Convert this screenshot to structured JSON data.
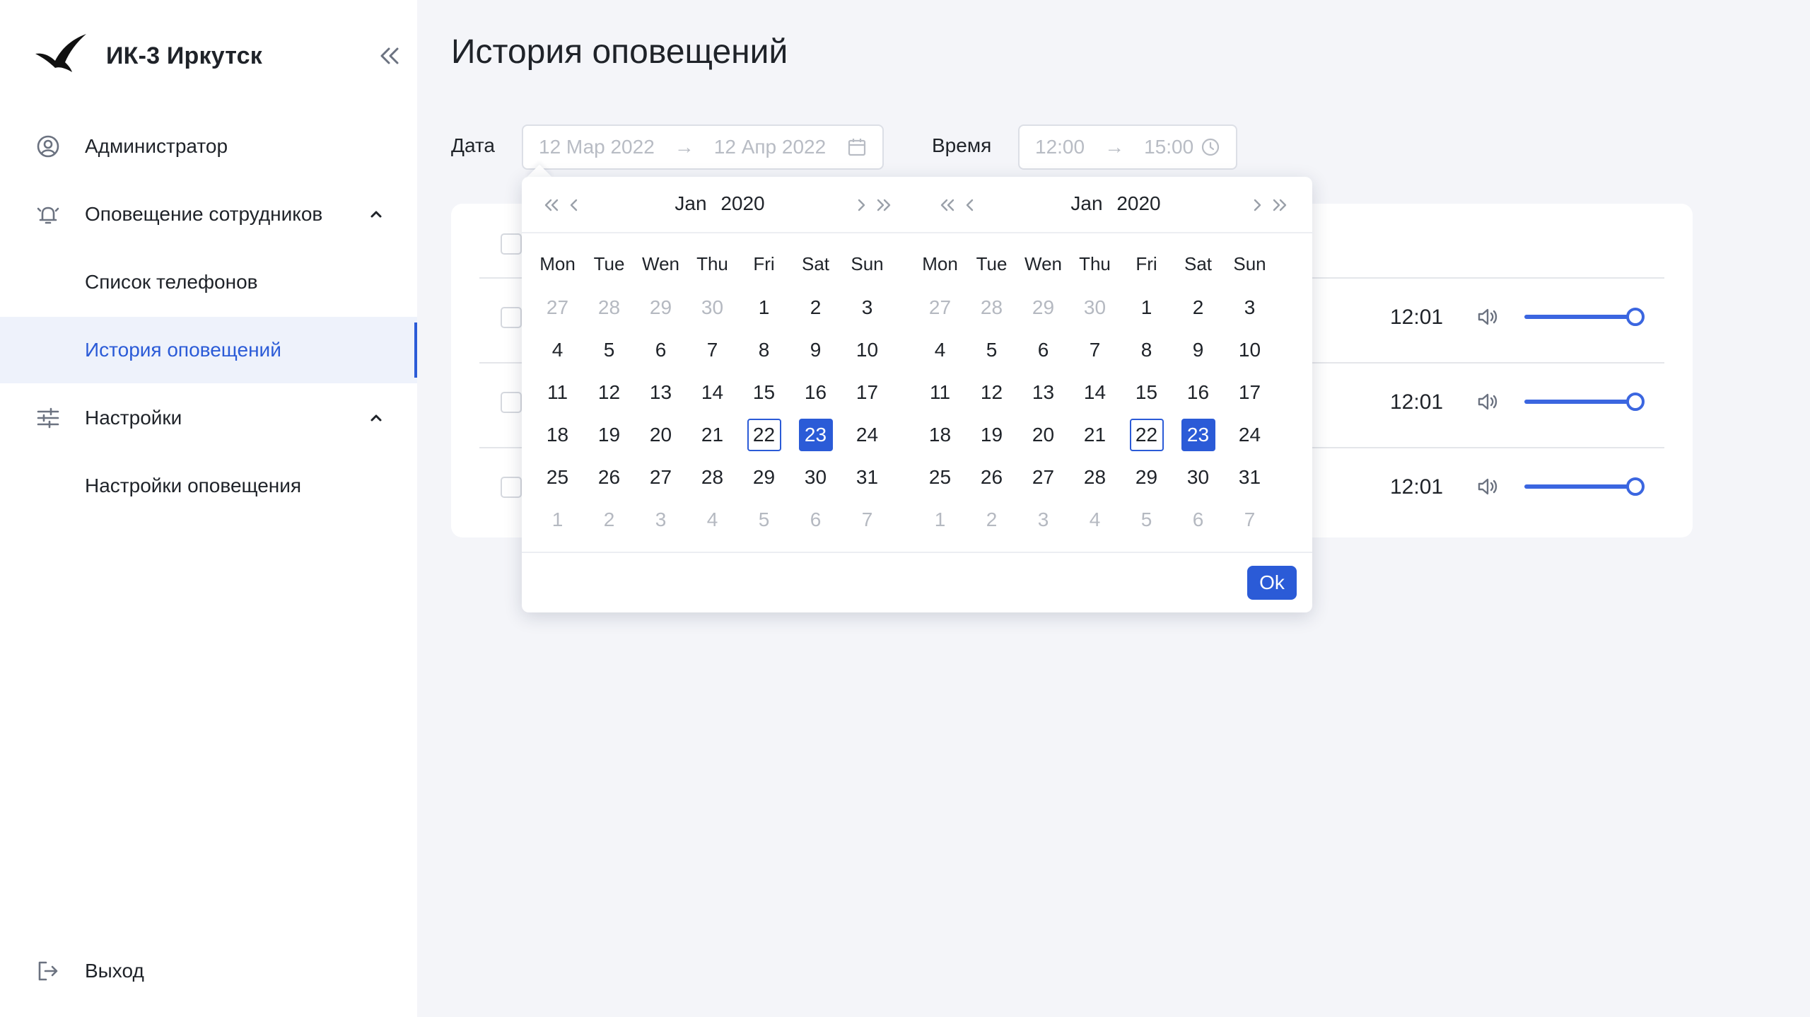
{
  "sidebar": {
    "brand": "ИК-3 Иркутск",
    "items": [
      {
        "label": "Администратор",
        "icon": "user-circle-icon"
      },
      {
        "label": "Оповещение сотрудников",
        "icon": "bell-icon"
      },
      {
        "label": "Список телефонов"
      },
      {
        "label": "История оповещений",
        "active": true
      },
      {
        "label": "Настройки",
        "icon": "sliders-icon"
      },
      {
        "label": "Настройки оповещения"
      }
    ],
    "logout": "Выход"
  },
  "main": {
    "title": "История оповещений",
    "filters": {
      "date_label": "Дата",
      "date_from": "12 Мар 2022",
      "date_to": "12 Апр 2022",
      "time_label": "Время",
      "time_from": "12:00",
      "time_to": "15:00",
      "arrow": "→"
    },
    "rows": [
      {
        "time": "12:01",
        "volume": 1.0
      },
      {
        "time": "12:01",
        "volume": 1.0
      },
      {
        "time": "12:01",
        "volume": 1.0
      }
    ]
  },
  "calendar": {
    "weekdays": [
      "Mon",
      "Tue",
      "Wen",
      "Thu",
      "Fri",
      "Sat",
      "Sun"
    ],
    "panels": [
      {
        "month": "Jan",
        "year": "2020"
      },
      {
        "month": "Jan",
        "year": "2020"
      }
    ],
    "days": [
      [
        "27",
        "28",
        "29",
        "30",
        "1",
        "2",
        "3"
      ],
      [
        "4",
        "5",
        "6",
        "7",
        "8",
        "9",
        "10"
      ],
      [
        "11",
        "12",
        "13",
        "14",
        "15",
        "16",
        "17"
      ],
      [
        "18",
        "19",
        "20",
        "21",
        "22",
        "23",
        "24"
      ],
      [
        "25",
        "26",
        "27",
        "28",
        "29",
        "30",
        "31"
      ],
      [
        "1",
        "2",
        "3",
        "4",
        "5",
        "6",
        "7"
      ]
    ],
    "today": "22",
    "selected": "23",
    "ok_label": "Ok"
  },
  "colors": {
    "accent": "#2b5bd7",
    "slider": "#3b66e0",
    "background": "#f4f5f9"
  }
}
